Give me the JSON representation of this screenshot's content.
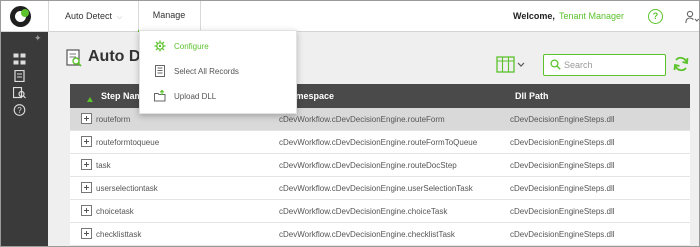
{
  "header": {
    "detect_label": "Auto Detect",
    "manage_tab": "Manage",
    "welcome": "Welcome,",
    "tenant": "Tenant Manager",
    "help": "?"
  },
  "menu": {
    "items": [
      {
        "label": "Configure",
        "icon": "gear-icon"
      },
      {
        "label": "Select All Records",
        "icon": "checklist-icon"
      },
      {
        "label": "Upload DLL",
        "icon": "upload-folder-icon"
      }
    ]
  },
  "page": {
    "title": "Auto D",
    "search_placeholder": "Search"
  },
  "table": {
    "columns": [
      "Step Name",
      "Namespace",
      "Dll Path"
    ],
    "rows": [
      [
        "routeform",
        "cDevWorkflow.cDevDecisionEngine.routeForm",
        "cDevDecisionEngineSteps.dll"
      ],
      [
        "routeformtoqueue",
        "cDevWorkflow.cDevDecisionEngine.routeFormToQueue",
        "cDevDecisionEngineSteps.dll"
      ],
      [
        "task",
        "cDevWorkflow.cDevDecisionEngine.routeDocStep",
        "cDevDecisionEngineSteps.dll"
      ],
      [
        "userselectiontask",
        "cDevWorkflow.cDevDecisionEngine.userSelectionTask",
        "cDevDecisionEngineSteps.dll"
      ],
      [
        "choicetask",
        "cDevWorkflow.cDevDecisionEngine.choiceTask",
        "cDevDecisionEngineSteps.dll"
      ],
      [
        "checklisttask",
        "cDevWorkflow.cDevDecisionEngine.checklistTask",
        "cDevDecisionEngineSteps.dll"
      ]
    ]
  },
  "colors": {
    "accent": "#5cc32d",
    "sidebar": "#3a3a3a",
    "table_header": "#4a4a4a",
    "selected_row": "#d9d9d9"
  }
}
